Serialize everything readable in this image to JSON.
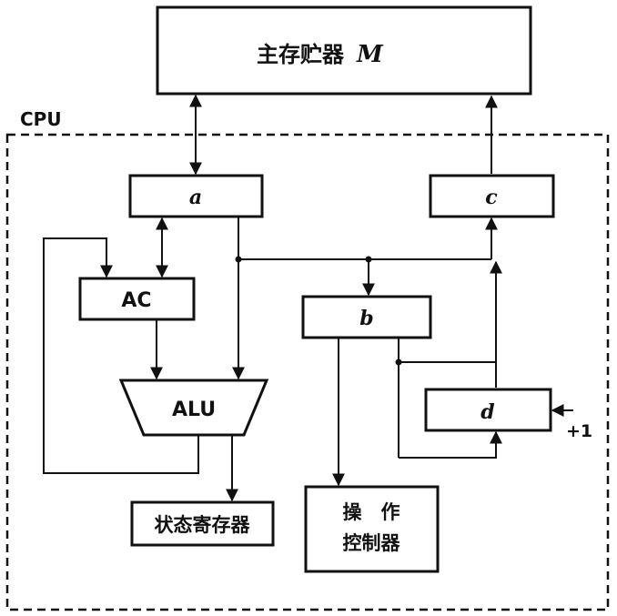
{
  "diagram": {
    "memory_label_cn": "主存贮器",
    "memory_label_m": "M",
    "cpu_label": "CPU",
    "reg_a": "a",
    "reg_b": "b",
    "reg_c": "c",
    "reg_d": "d",
    "ac": "AC",
    "alu": "ALU",
    "status_register": "状态寄存器",
    "op_control_line1": "操　作",
    "op_control_line2": "控制器",
    "plus_one": "+1"
  }
}
